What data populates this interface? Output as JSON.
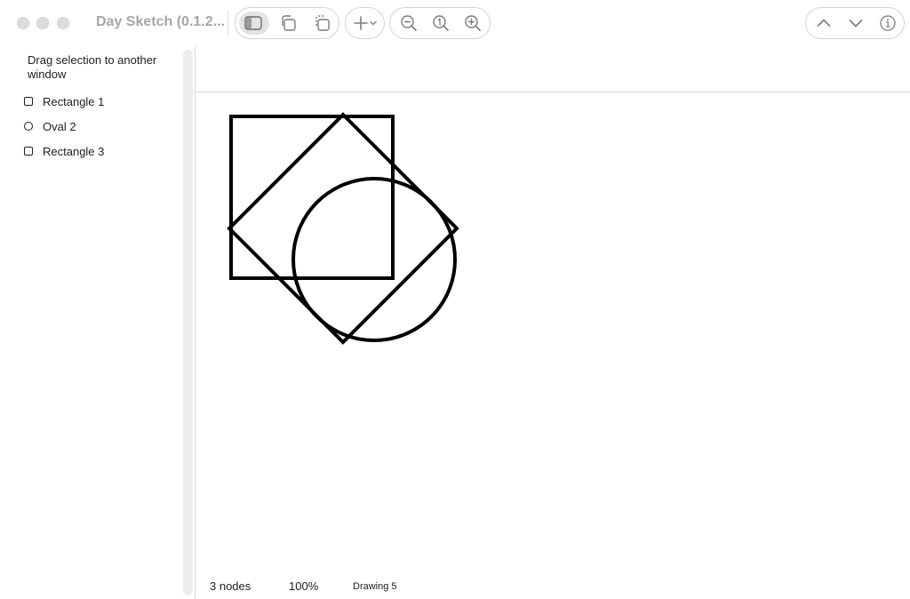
{
  "window": {
    "title": "Day Sketch (0.1.2...",
    "traffic_lights": [
      "close",
      "minimize",
      "zoom"
    ]
  },
  "toolbar": {
    "view_group": [
      {
        "icon": "sidebar-toggle-icon",
        "active": true
      },
      {
        "icon": "duplicate-icon"
      },
      {
        "icon": "copy-layers-icon"
      }
    ],
    "add": {
      "icon": "plus-icon",
      "dropdown_icon": "chevron-down-icon"
    },
    "zoom_group": [
      {
        "icon": "zoom-out-icon"
      },
      {
        "icon": "zoom-actual-size-icon"
      },
      {
        "icon": "zoom-in-icon"
      }
    ],
    "nav_group": [
      {
        "icon": "chevron-up-icon"
      },
      {
        "icon": "chevron-down-icon"
      },
      {
        "icon": "info-icon"
      }
    ]
  },
  "sidebar": {
    "header": "Drag selection to another window",
    "items": [
      {
        "label": "Rectangle 1",
        "icon": "rectangle-icon"
      },
      {
        "label": "Oval 2",
        "icon": "oval-icon"
      },
      {
        "label": "Rectangle 3",
        "icon": "rectangle-icon"
      }
    ]
  },
  "canvas": {
    "shapes": [
      {
        "name": "Rectangle 1",
        "type": "rectangle"
      },
      {
        "name": "Oval 2",
        "type": "oval"
      },
      {
        "name": "Rectangle 3",
        "type": "rectangle",
        "rotation_deg": 45
      }
    ],
    "stroke_color": "#000000"
  },
  "status_bar": {
    "node_count": "3 nodes",
    "zoom": "100%",
    "document_name": "Drawing 5"
  }
}
